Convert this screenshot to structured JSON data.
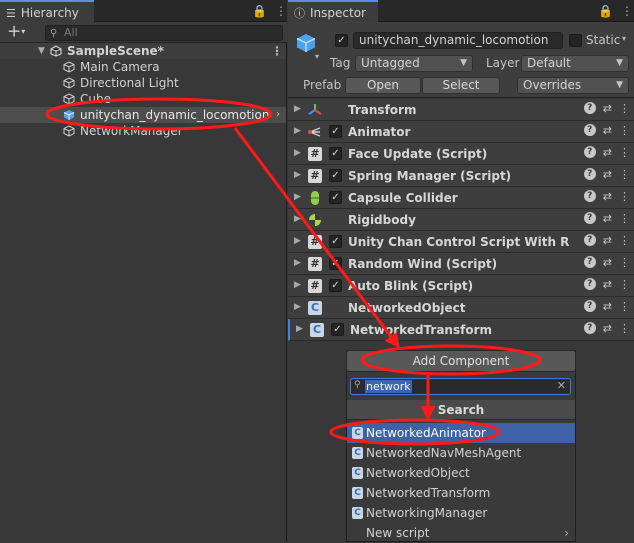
{
  "hierarchy": {
    "tab_label": "Hierarchy",
    "add_label": "+",
    "search_placeholder": "All",
    "scene": "SampleScene*",
    "items": [
      {
        "label": "Main Camera"
      },
      {
        "label": "Directional Light"
      },
      {
        "label": "Cube"
      },
      {
        "label": "unitychan_dynamic_locomotion"
      },
      {
        "label": "NetworkManager"
      }
    ]
  },
  "inspector": {
    "tab_label": "Inspector",
    "object_name": "unitychan_dynamic_locomotion",
    "static_label": "Static",
    "tag_label": "Tag",
    "tag_value": "Untagged",
    "layer_label": "Layer",
    "layer_value": "Default",
    "prefab_label": "Prefab",
    "open_label": "Open",
    "select_label": "Select",
    "overrides_label": "Overrides",
    "components": [
      {
        "name": "Transform",
        "icon": "transform-icon",
        "has_checkbox": false
      },
      {
        "name": "Animator",
        "icon": "animator-icon",
        "has_checkbox": true
      },
      {
        "name": "Face Update (Script)",
        "icon": "script-icon",
        "has_checkbox": true
      },
      {
        "name": "Spring Manager (Script)",
        "icon": "script-icon",
        "has_checkbox": true
      },
      {
        "name": "Capsule Collider",
        "icon": "capsule-collider-icon",
        "has_checkbox": true
      },
      {
        "name": "Rigidbody",
        "icon": "rigidbody-icon",
        "has_checkbox": false
      },
      {
        "name": "Unity Chan Control Script With Rgid Bo",
        "icon": "script-icon",
        "has_checkbox": true
      },
      {
        "name": "Random Wind (Script)",
        "icon": "script-icon",
        "has_checkbox": true
      },
      {
        "name": "Auto Blink (Script)",
        "icon": "script-icon",
        "has_checkbox": true
      },
      {
        "name": "NetworkedObject",
        "icon": "csharp-script-icon",
        "has_checkbox": false
      },
      {
        "name": "NetworkedTransform",
        "icon": "csharp-script-icon",
        "has_checkbox": true
      }
    ]
  },
  "add_component": {
    "button_label": "Add Component",
    "search_value": "network",
    "header": "Search",
    "results": [
      {
        "label": "NetworkedAnimator"
      },
      {
        "label": "NetworkedNavMeshAgent"
      },
      {
        "label": "NetworkedObject"
      },
      {
        "label": "NetworkedTransform"
      },
      {
        "label": "NetworkingManager"
      },
      {
        "label": "New script"
      }
    ]
  },
  "colors": {
    "highlight": "#ff1a1a",
    "selection": "#3d62a6"
  }
}
